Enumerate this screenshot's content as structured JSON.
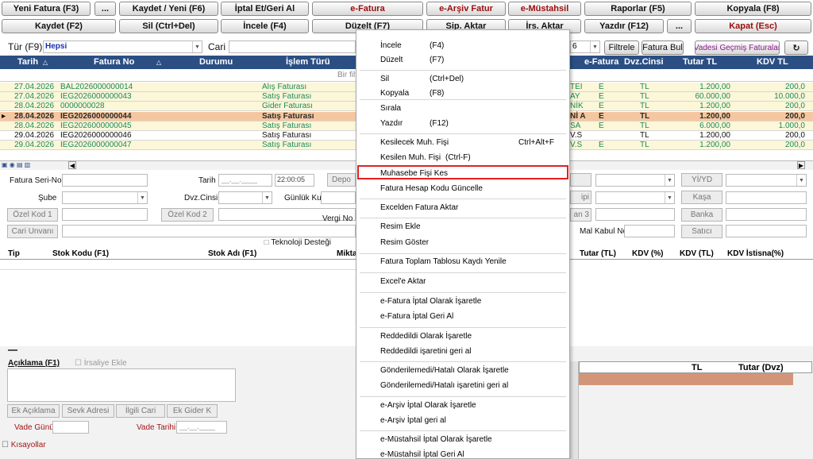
{
  "toolbar": {
    "row1": [
      {
        "label": "Yeni Fatura (F3)"
      },
      {
        "label": "..."
      },
      {
        "label": "Kaydet / Yeni (F6)"
      },
      {
        "label": "İptal Et/Geri Al"
      },
      {
        "label": "e-Fatura"
      },
      {
        "label": "e-Arşiv Fatur"
      },
      {
        "label": "e-Müstahsil"
      },
      {
        "label": "Raporlar (F5)"
      },
      {
        "label": "Kopyala (F8)"
      }
    ],
    "row2": [
      {
        "label": "Kaydet (F2)"
      },
      {
        "label": "Sil (Ctrl+Del)"
      },
      {
        "label": "İncele (F4)"
      },
      {
        "label": "Düzelt (F7)"
      },
      {
        "label": "Sip. Aktar"
      },
      {
        "label": "İrs. Aktar"
      },
      {
        "label": "Yazdır (F12)"
      },
      {
        "label": "..."
      },
      {
        "label": "Kapat (Esc)"
      }
    ]
  },
  "filter": {
    "tur_label": "Tür (F9)",
    "tur_value": "Hepsi",
    "cari_label": "Cari",
    "page_number": "6",
    "filtrele": "Filtrele",
    "fatura_bul": "Fatura Bul",
    "vadesi": "Vadesi Geçmiş Faturalar",
    "refresh_icon": "↻"
  },
  "grid": {
    "columns": [
      "Tarih",
      "Fatura No",
      "Durumu",
      "İşlem Türü",
      "e-Fatura",
      "Dvz.Cinsi",
      "Tutar TL",
      "KDV TL"
    ],
    "filter_hint": "Bir filt",
    "rows": [
      {
        "tarih": "27.04.2026",
        "fatura_no": "BAL2026000000014",
        "islem": "Alış Faturası",
        "cut": "TEI",
        "efatura": "E",
        "dvz": "TL",
        "tutar": "1.200,00",
        "kdv": "200,0",
        "bg": "#fbf7d8",
        "color": "#1c8a5c"
      },
      {
        "tarih": "27.04.2026",
        "fatura_no": "IEG2026000000043",
        "islem": "Satış Faturası",
        "cut": "AY",
        "efatura": "E",
        "dvz": "TL",
        "tutar": "60.000,00",
        "kdv": "10.000,0",
        "bg": "#fbf7d8",
        "color": "#1c8a5c"
      },
      {
        "tarih": "28.04.2026",
        "fatura_no": "0000000028",
        "islem": "Gider Faturası",
        "cut": "NİK",
        "efatura": "E",
        "dvz": "TL",
        "tutar": "1.200,00",
        "kdv": "200,0",
        "bg": "#fbf7d8",
        "color": "#1c8a5c"
      },
      {
        "tarih": "28.04.2026",
        "fatura_no": "IEG2026000000044",
        "islem": "Satış Faturası",
        "cut": "Nİ A",
        "efatura": "E",
        "dvz": "TL",
        "tutar": "1.200,00",
        "kdv": "200,0",
        "bg": "#f5c7a0",
        "color": "#2a2a2a",
        "bold": true
      },
      {
        "tarih": "28.04.2026",
        "fatura_no": "IEG2026000000045",
        "islem": "Satış Faturası",
        "cut": "SA",
        "efatura": "E",
        "dvz": "TL",
        "tutar": "6.000,00",
        "kdv": "1.000,0",
        "bg": "#fbf7d8",
        "color": "#1c8a5c"
      },
      {
        "tarih": "29.04.2026",
        "fatura_no": "IEG2026000000046",
        "islem": "Satış Faturası",
        "cut": "V.S",
        "efatura": "",
        "dvz": "TL",
        "tutar": "1.200,00",
        "kdv": "200,0",
        "bg": "#ffffff",
        "color": "#111111"
      },
      {
        "tarih": "29.04.2026",
        "fatura_no": "IEG2026000000047",
        "islem": "Satış Faturası",
        "cut": "V.S",
        "efatura": "E",
        "dvz": "TL",
        "tutar": "1.200,00",
        "kdv": "200,0",
        "bg": "#fbf7d8",
        "color": "#1c8a5c"
      }
    ]
  },
  "form": {
    "fatura_seri_no": "Fatura Seri-No",
    "tarih": "Tarih",
    "tarih_value": "__.__.____",
    "time_value": "22:00:05",
    "depo": "Depo",
    "sube": "Şube",
    "dvz_cinsi": "Dvz.Cinsi",
    "gunluk_kur": "Günlük Kur",
    "ozel_kod_1": "Özel Kod 1",
    "ozel_kod_2": "Özel Kod 2",
    "vergi_no": "Vergi No",
    "cari_unvani": "Cari Unvanı",
    "teknoloji": "Teknoloji Desteği",
    "mal_kabul": "Mal Kabul No",
    "yi_yd": "Yİ/YD",
    "kasa": "Kaşa",
    "banka": "Banka",
    "satici": "Satıcı",
    "tipi_cut": "ipi",
    "an3_cut": "an 3"
  },
  "lines_grid": {
    "left_columns": [
      "Tip",
      "Stok Kodu (F1)",
      "Stok Adı (F1)",
      "Mikta"
    ],
    "right_columns": [
      "Tutar (TL)",
      "KDV (%)",
      "KDV (TL)",
      "KDV İstisna(%)"
    ]
  },
  "bottom": {
    "aciklama": "Açıklama (F1)",
    "irsaliye": "İrsaliye Ekle",
    "ek_aciklama": "Ek Açıklama",
    "sevk_adresi": "Sevk Adresi",
    "ilgili_cari": "İlgili Cari",
    "ek_gider": "Ek Gider K",
    "vade_gunu": "Vade Günü",
    "vade_tarihi": "Vade Tarihi",
    "vade_tarihi_value": "__.__.____",
    "kisayollar": "Kısayollar",
    "tl": "TL",
    "tutar_dvz": "Tutar (Dvz)"
  },
  "context_menu": {
    "items": [
      {
        "label": "İncele",
        "shortcut": "(F4)"
      },
      {
        "label": "Düzelt",
        "shortcut": "(F7)"
      },
      {
        "label": "Sil",
        "shortcut": "(Ctrl+Del)"
      },
      {
        "label": "Kopyala",
        "shortcut": "(F8)"
      },
      {
        "label": "Sırala",
        "shortcut": ""
      },
      {
        "label": "Yazdır",
        "shortcut": "(F12)"
      },
      {
        "label": "Kesilecek Muh. Fişi",
        "shortcut": "Ctrl+Alt+F"
      },
      {
        "label": "Kesilen Muh. Fişi",
        "shortcut": "(Ctrl-F)"
      },
      {
        "label": "Muhasebe Fişi Kes",
        "shortcut": ""
      },
      {
        "label": "Fatura Hesap Kodu Güncelle",
        "shortcut": ""
      },
      {
        "label": "Excelden Fatura Aktar",
        "shortcut": ""
      },
      {
        "label": "Resim Ekle",
        "shortcut": ""
      },
      {
        "label": "Resim Göster",
        "shortcut": ""
      },
      {
        "label": "Fatura Toplam Tablosu Kaydı Yenile",
        "shortcut": ""
      },
      {
        "label": "Excel'e Aktar",
        "shortcut": ""
      },
      {
        "label": "e-Fatura İptal Olarak İşaretle",
        "shortcut": ""
      },
      {
        "label": "e-Fatura İptal Geri Al",
        "shortcut": ""
      },
      {
        "label": "Reddedildi Olarak İşaretle",
        "shortcut": ""
      },
      {
        "label": "Reddedildi işaretini geri al",
        "shortcut": ""
      },
      {
        "label": "Gönderilemedi/Hatalı Olarak İşaretle",
        "shortcut": ""
      },
      {
        "label": "Gönderilemedi/Hatalı işaretini geri al",
        "shortcut": ""
      },
      {
        "label": "e-Arşiv İptal Olarak İşaretle",
        "shortcut": ""
      },
      {
        "label": "e-Arşiv İptal geri al",
        "shortcut": ""
      },
      {
        "label": "e-Müstahsil İptal Olarak İşaretle",
        "shortcut": ""
      },
      {
        "label": "e-Müstahsil İptal Geri Al",
        "shortcut": ""
      }
    ],
    "highlight_color": "#e32020"
  }
}
